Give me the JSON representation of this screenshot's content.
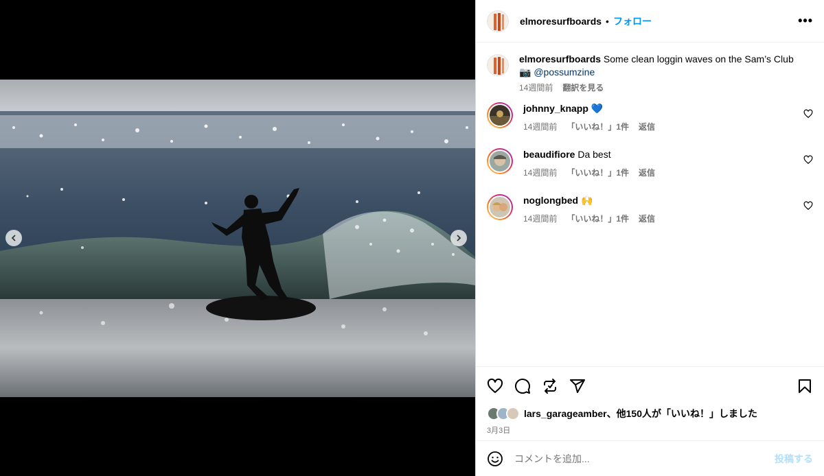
{
  "post": {
    "author": "elmoresurfboards",
    "follow_label": "フォロー",
    "separator": "•",
    "more_label": "•••",
    "caption": {
      "username": "elmoresurfboards",
      "text": " Some clean loggin waves on the Sam’s Club",
      "camera": "📷",
      "mention": "@possumzine",
      "time": "14週間前",
      "translate": "翻訳を見る"
    }
  },
  "comments": [
    {
      "username": "johnny_knapp",
      "text": "💙",
      "time": "14週間前",
      "likes": "「いいね！」1件",
      "reply": "返信"
    },
    {
      "username": "beaudifiore",
      "text": "Da best",
      "time": "14週間前",
      "likes": "「いいね！」1件",
      "reply": "返信"
    },
    {
      "username": "noglongbed",
      "text": "🙌",
      "time": "14週間前",
      "likes": "「いいね！」1件",
      "reply": "返信"
    }
  ],
  "likes": {
    "user": "lars_garageamber",
    "rest": "、他150人が「いいね！」しました",
    "date": "3月3日"
  },
  "add_comment": {
    "placeholder": "コメントを追加...",
    "post_label": "投稿する"
  },
  "colors": {
    "accent": "#0095f6",
    "link": "#00376b",
    "post_disabled": "#b2dffc",
    "meta": "#737373"
  },
  "icons": {
    "like": "heart-icon",
    "comment": "comment-icon",
    "repost": "repost-icon",
    "share": "send-icon",
    "save": "bookmark-icon",
    "emoji": "emoji-icon",
    "prev": "chevron-left-icon",
    "next": "chevron-right-icon"
  }
}
